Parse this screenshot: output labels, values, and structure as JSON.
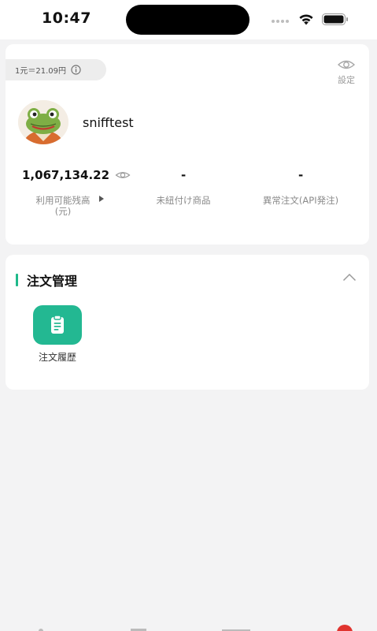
{
  "status_bar": {
    "time": "10:47"
  },
  "account": {
    "exchange_rate": "1元＝21.09円",
    "settings_label": "設定",
    "username": "snifftest",
    "stats": [
      {
        "value": "1,067,134.22",
        "label": "利用可能残高(元)"
      },
      {
        "value": "-",
        "label": "未紐付け商品"
      },
      {
        "value": "-",
        "label": "異常注文(API発注)"
      }
    ]
  },
  "order_management": {
    "title": "注文管理",
    "items": [
      {
        "label": "注文履歴",
        "icon": "clipboard-icon"
      }
    ]
  },
  "colors": {
    "accent": "#1fb98a",
    "background": "#f3f3f4",
    "card": "#ffffff"
  }
}
